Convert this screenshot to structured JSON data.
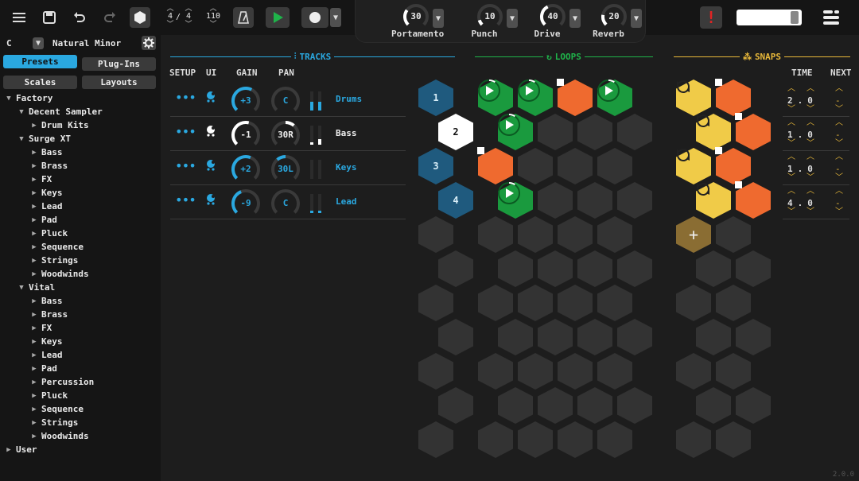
{
  "toolbar": {
    "time_sig_num": "4",
    "time_sig_den": "4",
    "time_sig_sep": "/",
    "tempo": "110",
    "knobs": [
      {
        "value": "30",
        "label": "Portamento",
        "fraction": 0.3
      },
      {
        "value": "10",
        "label": "Punch",
        "fraction": 0.1
      },
      {
        "value": "40",
        "label": "Drive",
        "fraction": 0.4
      },
      {
        "value": "20",
        "label": "Reverb",
        "fraction": 0.2
      }
    ],
    "alert": "!",
    "accent": "#2aa8e0",
    "green": "#1a9a3e"
  },
  "sidebar": {
    "key": "C",
    "scale": "Natural Minor",
    "tabs": [
      {
        "label": "Presets",
        "active": true
      },
      {
        "label": "Plug-Ins",
        "active": false
      },
      {
        "label": "Scales",
        "active": false
      },
      {
        "label": "Layouts",
        "active": false
      }
    ],
    "tree": [
      {
        "label": "Factory",
        "depth": 0,
        "open": true
      },
      {
        "label": "Decent Sampler",
        "depth": 1,
        "open": true
      },
      {
        "label": "Drum Kits",
        "depth": 2,
        "open": false
      },
      {
        "label": "Surge XT",
        "depth": 1,
        "open": true
      },
      {
        "label": "Bass",
        "depth": 2,
        "open": false
      },
      {
        "label": "Brass",
        "depth": 2,
        "open": false
      },
      {
        "label": "FX",
        "depth": 2,
        "open": false
      },
      {
        "label": "Keys",
        "depth": 2,
        "open": false
      },
      {
        "label": "Lead",
        "depth": 2,
        "open": false
      },
      {
        "label": "Pad",
        "depth": 2,
        "open": false
      },
      {
        "label": "Pluck",
        "depth": 2,
        "open": false
      },
      {
        "label": "Sequence",
        "depth": 2,
        "open": false
      },
      {
        "label": "Strings",
        "depth": 2,
        "open": false
      },
      {
        "label": "Woodwinds",
        "depth": 2,
        "open": false
      },
      {
        "label": "Vital",
        "depth": 1,
        "open": true
      },
      {
        "label": "Bass",
        "depth": 2,
        "open": false
      },
      {
        "label": "Brass",
        "depth": 2,
        "open": false
      },
      {
        "label": "FX",
        "depth": 2,
        "open": false
      },
      {
        "label": "Keys",
        "depth": 2,
        "open": false
      },
      {
        "label": "Lead",
        "depth": 2,
        "open": false
      },
      {
        "label": "Pad",
        "depth": 2,
        "open": false
      },
      {
        "label": "Percussion",
        "depth": 2,
        "open": false
      },
      {
        "label": "Pluck",
        "depth": 2,
        "open": false
      },
      {
        "label": "Sequence",
        "depth": 2,
        "open": false
      },
      {
        "label": "Strings",
        "depth": 2,
        "open": false
      },
      {
        "label": "Woodwinds",
        "depth": 2,
        "open": false
      },
      {
        "label": "User",
        "depth": 0,
        "open": false
      }
    ]
  },
  "sections": {
    "tracks": "TRACKS",
    "loops": "LOOPS",
    "snaps": "SNAPS"
  },
  "columns": {
    "setup": "SETUP",
    "ui": "UI",
    "gain": "GAIN",
    "pan": "PAN",
    "time": "TIME",
    "next": "NEXT"
  },
  "tracks": [
    {
      "name": "Drums",
      "gain": "+3",
      "pan": "C",
      "gain_fraction": 0.6,
      "pan_fraction": 0,
      "active": true,
      "meter": [
        0.45,
        0.45
      ],
      "color": "#2aa8e0"
    },
    {
      "name": "Bass",
      "gain": "-1",
      "pan": "30R",
      "gain_fraction": 0.55,
      "pan_fraction": 0.3,
      "active": false,
      "meter": [
        0.1,
        0.3
      ],
      "color": "#ffffff"
    },
    {
      "name": "Keys",
      "gain": "+2",
      "pan": "30L",
      "gain_fraction": 0.58,
      "pan_fraction": -0.3,
      "active": true,
      "meter": [
        0,
        0
      ],
      "color": "#2aa8e0"
    },
    {
      "name": "Lead",
      "gain": "-9",
      "pan": "C",
      "gain_fraction": 0.42,
      "pan_fraction": 0,
      "active": true,
      "meter": [
        0.1,
        0.1
      ],
      "color": "#2aa8e0"
    }
  ],
  "track_hexes": [
    "1",
    "2",
    "3",
    "4"
  ],
  "loops": [
    [
      "play",
      "play",
      "stop",
      "play"
    ],
    [
      "play",
      "",
      "",
      ""
    ],
    [
      "stop",
      "",
      "",
      ""
    ],
    [
      "play",
      "",
      "",
      ""
    ]
  ],
  "snaps": [
    [
      "cycle",
      "stop"
    ],
    [
      "cycle",
      "stop"
    ],
    [
      "cycle",
      "stop"
    ],
    [
      "cycle",
      "stop"
    ],
    [
      "add",
      ""
    ]
  ],
  "timers": [
    {
      "time": "2.0",
      "next": "-"
    },
    {
      "time": "1.0",
      "next": "-"
    },
    {
      "time": "1.0",
      "next": "-"
    },
    {
      "time": "4.0",
      "next": "-"
    }
  ],
  "version": "2.0.0"
}
